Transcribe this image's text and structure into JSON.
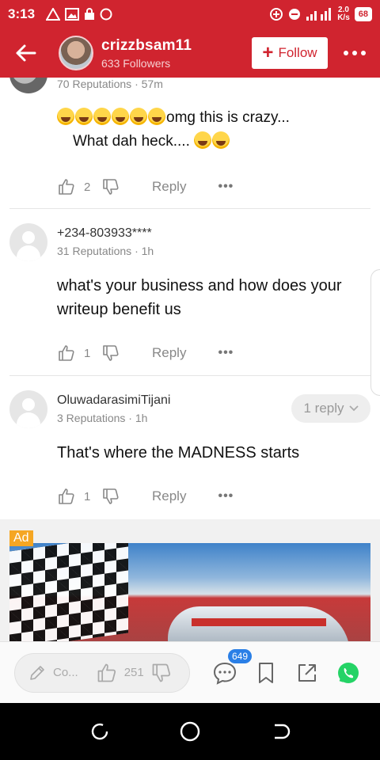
{
  "status_bar": {
    "time": "3:13",
    "network_speed_value": "2.0",
    "network_speed_unit": "K/s",
    "battery": "68"
  },
  "header": {
    "username": "crizzbsam11",
    "followers": "633 Followers",
    "follow_label": "Follow",
    "follow_plus": "+"
  },
  "comments": [
    {
      "meta": "70 Reputations · 57m",
      "text_line1": "omg this is crazy...",
      "text_line2": "What dah heck....",
      "likes": "2",
      "reply_label": "Reply"
    },
    {
      "name": "+234-803933****",
      "meta": "31 Reputations · 1h",
      "text": "what's your business and how does your writeup benefit us",
      "likes": "1",
      "reply_label": "Reply"
    },
    {
      "name": "OluwadarasimiTijani",
      "meta": "3 Reputations · 1h",
      "text": "That's where the MADNESS starts",
      "likes": "1",
      "reply_label": "Reply",
      "replies_label": "1 reply"
    }
  ],
  "ad": {
    "label": "Ad"
  },
  "bottom_bar": {
    "comment_placeholder": "Co...",
    "likes": "251",
    "comment_badge": "649"
  },
  "colors": {
    "brand": "#d0242f",
    "badge": "#2a7fe6",
    "whatsapp": "#25d366"
  }
}
